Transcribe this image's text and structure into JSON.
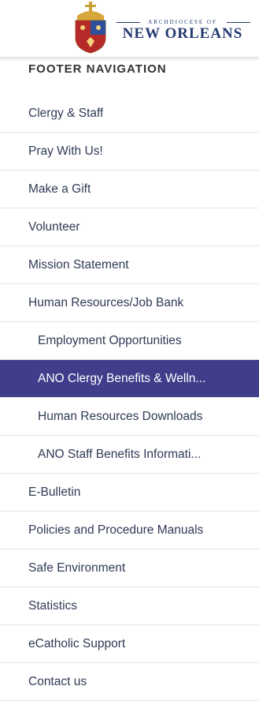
{
  "brand": {
    "small": "ARCHDIOCESE OF",
    "big": "NEW ORLEANS"
  },
  "footer_nav": {
    "title": "FOOTER NAVIGATION",
    "items": [
      {
        "label": "Clergy & Staff"
      },
      {
        "label": "Pray With Us!"
      },
      {
        "label": "Make a Gift"
      },
      {
        "label": "Volunteer"
      },
      {
        "label": "Mission Statement"
      },
      {
        "label": "Human Resources/Job Bank"
      },
      {
        "label": "Employment Opportunities"
      },
      {
        "label": "ANO Clergy Benefits & Welln..."
      },
      {
        "label": "Human Resources Downloads"
      },
      {
        "label": "ANO Staff Benefits Informati..."
      },
      {
        "label": "E-Bulletin"
      },
      {
        "label": "Policies and Procedure Manuals"
      },
      {
        "label": "Safe Environment"
      },
      {
        "label": "Statistics"
      },
      {
        "label": "eCatholic Support"
      },
      {
        "label": "Contact us"
      }
    ]
  },
  "colors": {
    "active_bg": "#403d8b",
    "brand_navy": "#233a70",
    "crest_red": "#b62a2a",
    "crest_gold": "#d8a53a"
  }
}
